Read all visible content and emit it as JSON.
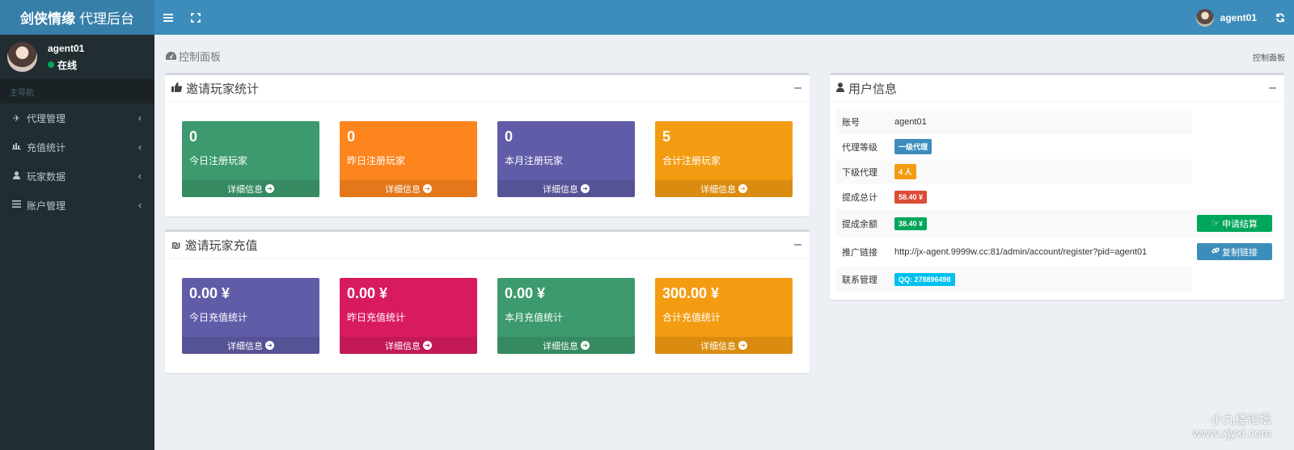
{
  "brand": {
    "bold": "剑侠情缘",
    "rest": "代理后台"
  },
  "topbar": {
    "username": "agent01"
  },
  "sidebar": {
    "user": {
      "name": "agent01",
      "status": "在线"
    },
    "header": "主导航",
    "items": [
      {
        "label": "代理管理",
        "icon": "plane-icon"
      },
      {
        "label": "充值统计",
        "icon": "bar-chart-icon"
      },
      {
        "label": "玩家数据",
        "icon": "user-icon"
      },
      {
        "label": "账户管理",
        "icon": "list-icon"
      }
    ]
  },
  "content": {
    "title": "控制面板",
    "breadcrumb": "控制面板"
  },
  "invite_stats": {
    "title": "邀请玩家统计",
    "tiles": [
      {
        "value": "0",
        "label": "今日注册玩家",
        "footer": "详细信息",
        "color": "#3c9a6e"
      },
      {
        "value": "0",
        "label": "昨日注册玩家",
        "footer": "详细信息",
        "color": "#fd851e"
      },
      {
        "value": "0",
        "label": "本月注册玩家",
        "footer": "详细信息",
        "color": "#605ca8"
      },
      {
        "value": "5",
        "label": "合计注册玩家",
        "footer": "详细信息",
        "color": "#f39c12"
      }
    ]
  },
  "invite_recharge": {
    "title": "邀请玩家充值",
    "tiles": [
      {
        "value": "0.00 ¥",
        "label": "今日充值统计",
        "footer": "详细信息",
        "color": "#605ca8"
      },
      {
        "value": "0.00 ¥",
        "label": "昨日充值统计",
        "footer": "详细信息",
        "color": "#d81b60"
      },
      {
        "value": "0.00 ¥",
        "label": "本月充值统计",
        "footer": "详细信息",
        "color": "#3c9a6e"
      },
      {
        "value": "300.00 ¥",
        "label": "合计充值统计",
        "footer": "详细信息",
        "color": "#f39c12"
      }
    ]
  },
  "user_info": {
    "title": "用户信息",
    "rows": [
      {
        "key": "账号",
        "value": "agent01"
      },
      {
        "key": "代理等级",
        "badge": "一级代理",
        "color": "#3c8dbc"
      },
      {
        "key": "下级代理",
        "badge": "4 人",
        "color": "#f39c12"
      },
      {
        "key": "提成总计",
        "badge": "58.40 ¥",
        "color": "#dd4b39"
      },
      {
        "key": "提成余额",
        "badge": "38.40 ¥",
        "color": "#00a65a"
      },
      {
        "key": "推广链接",
        "value": "http://jx-agent.9999w.cc:81/admin/account/register?pid=agent01"
      },
      {
        "key": "联系管理",
        "badge": "QQ:  278896498",
        "color": "#00c0ef"
      }
    ],
    "settle_button": "申请结算",
    "copy_button": "复制链接"
  },
  "watermark": {
    "line1": "小九楼论坛",
    "line2": "www.xjyxi.com"
  }
}
